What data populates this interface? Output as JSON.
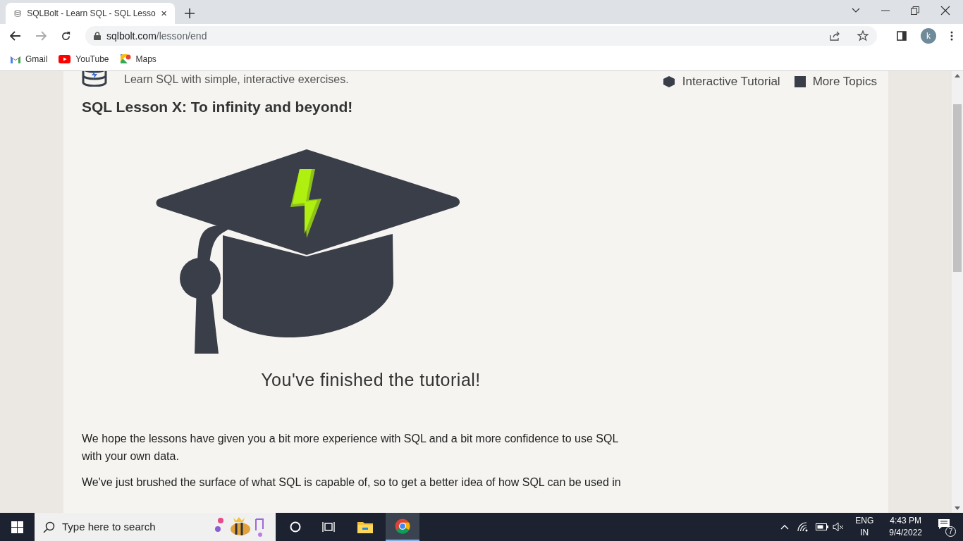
{
  "browser": {
    "tab": {
      "title": "SQLBolt - Learn SQL - SQL Lesso",
      "selected": true
    },
    "url_host": "sqlbolt.com",
    "url_path": "/lesson/end",
    "profile_initial": "k",
    "bookmarks": [
      "Gmail",
      "YouTube",
      "Maps"
    ]
  },
  "page": {
    "tagline": "Learn SQL with simple, interactive exercises.",
    "nav": [
      "Interactive Tutorial",
      "More Topics"
    ],
    "heading": "SQL Lesson X: To infinity and beyond!",
    "caption": "You've finished the tutorial!",
    "paragraphs": [
      "We hope the lessons have given you a bit more experience with SQL and a bit more confidence to use SQL with your own data.",
      "We've just brushed the surface of what SQL is capable of, so to get a better idea of how SQL can be used in"
    ]
  },
  "taskbar": {
    "search_placeholder": "Type here to search",
    "language": "ENG",
    "region": "IN",
    "time": "4:43 PM",
    "date": "9/4/2022",
    "notifications": "7"
  }
}
